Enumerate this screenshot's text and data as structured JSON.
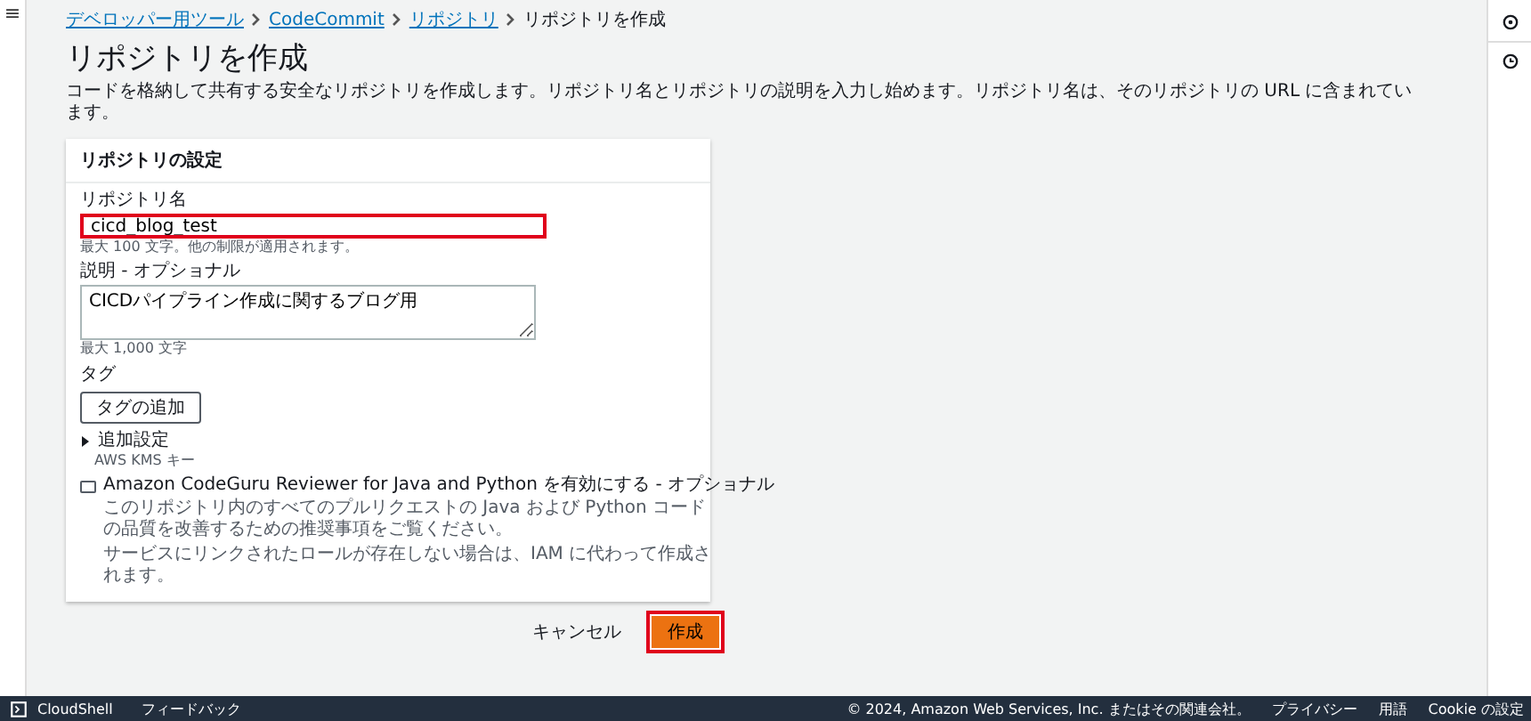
{
  "menu_icon": "≡",
  "breadcrumb": [
    {
      "label": "デベロッパー用ツール",
      "link": true
    },
    {
      "label": "CodeCommit",
      "link": true
    },
    {
      "label": "リポジトリ",
      "link": true
    },
    {
      "label": "リポジトリを作成",
      "link": false
    }
  ],
  "title": "リポジトリを作成",
  "description": "コードを格納して共有する安全なリポジトリを作成します。リポジトリ名とリポジトリの説明を入力し始めます。リポジトリ名は、そのリポジトリの URL に含まれています。",
  "settings": {
    "title": "リポジトリの設定",
    "name_field": {
      "label": "リポジトリ名",
      "value": "cicd_blog_test",
      "hint": "最大 100 文字。他の制限が適用されます。",
      "highlighted": true
    },
    "description_field": {
      "label": "説明 - オプショナル",
      "value": "CICDパイプライン作成に関するブログ用",
      "hint": "最大 1,000 文字"
    },
    "tags": {
      "label": "タグ",
      "button": "タグの追加"
    },
    "additional": {
      "label": "追加設定",
      "sub": "AWS KMS キー",
      "expanded": false
    },
    "codeguru": {
      "label": "Amazon CodeGuru Reviewer for Java and Python を有効にする - オプショナル",
      "checked": false,
      "help": "このリポジトリ内のすべてのプルリクエストの Java および Python コードの品質を改善するための推奨事項をご覧ください。",
      "note": "サービスにリンクされたロールが存在しない場合は、IAM に代わって作成されます。"
    }
  },
  "actions": {
    "cancel": "キャンセル",
    "create": "作成",
    "create_highlighted": true
  },
  "footer": {
    "left": [
      "CloudShell",
      "フィードバック"
    ],
    "right": [
      "© 2024, Amazon Web Services, Inc. またはその関連会社。",
      "プライバシー",
      "用語",
      "Cookie の設定"
    ]
  }
}
